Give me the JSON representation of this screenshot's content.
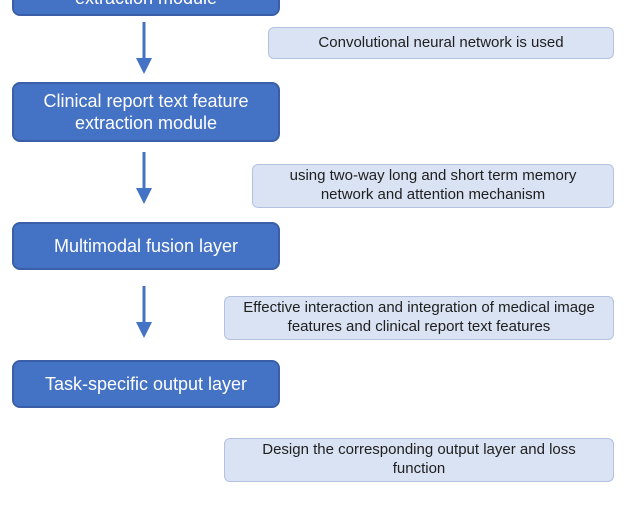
{
  "colors": {
    "stage_fill": "#4472c4",
    "stage_border": "#3a5fa8",
    "note_fill": "#dae3f3",
    "note_border": "#b4c2e0",
    "arrow": "#4472c4"
  },
  "stages": [
    {
      "id": "stage1",
      "label": "extraction module"
    },
    {
      "id": "stage2",
      "label": "Clinical report text feature extraction module"
    },
    {
      "id": "stage3",
      "label": "Multimodal fusion layer"
    },
    {
      "id": "stage4",
      "label": "Task-specific output layer"
    }
  ],
  "notes": [
    {
      "id": "note1",
      "text": "Convolutional neural network is used"
    },
    {
      "id": "note2",
      "text": "using two-way long and short term memory network and attention mechanism"
    },
    {
      "id": "note3",
      "text": "Effective interaction and integration of medical image features and clinical report text features"
    },
    {
      "id": "note4",
      "text": "Design the corresponding output layer and loss function"
    }
  ],
  "arrows": [
    {
      "id": "arrow1",
      "from": "stage1",
      "to": "stage2"
    },
    {
      "id": "arrow2",
      "from": "stage2",
      "to": "stage3"
    },
    {
      "id": "arrow3",
      "from": "stage3",
      "to": "stage4"
    }
  ]
}
